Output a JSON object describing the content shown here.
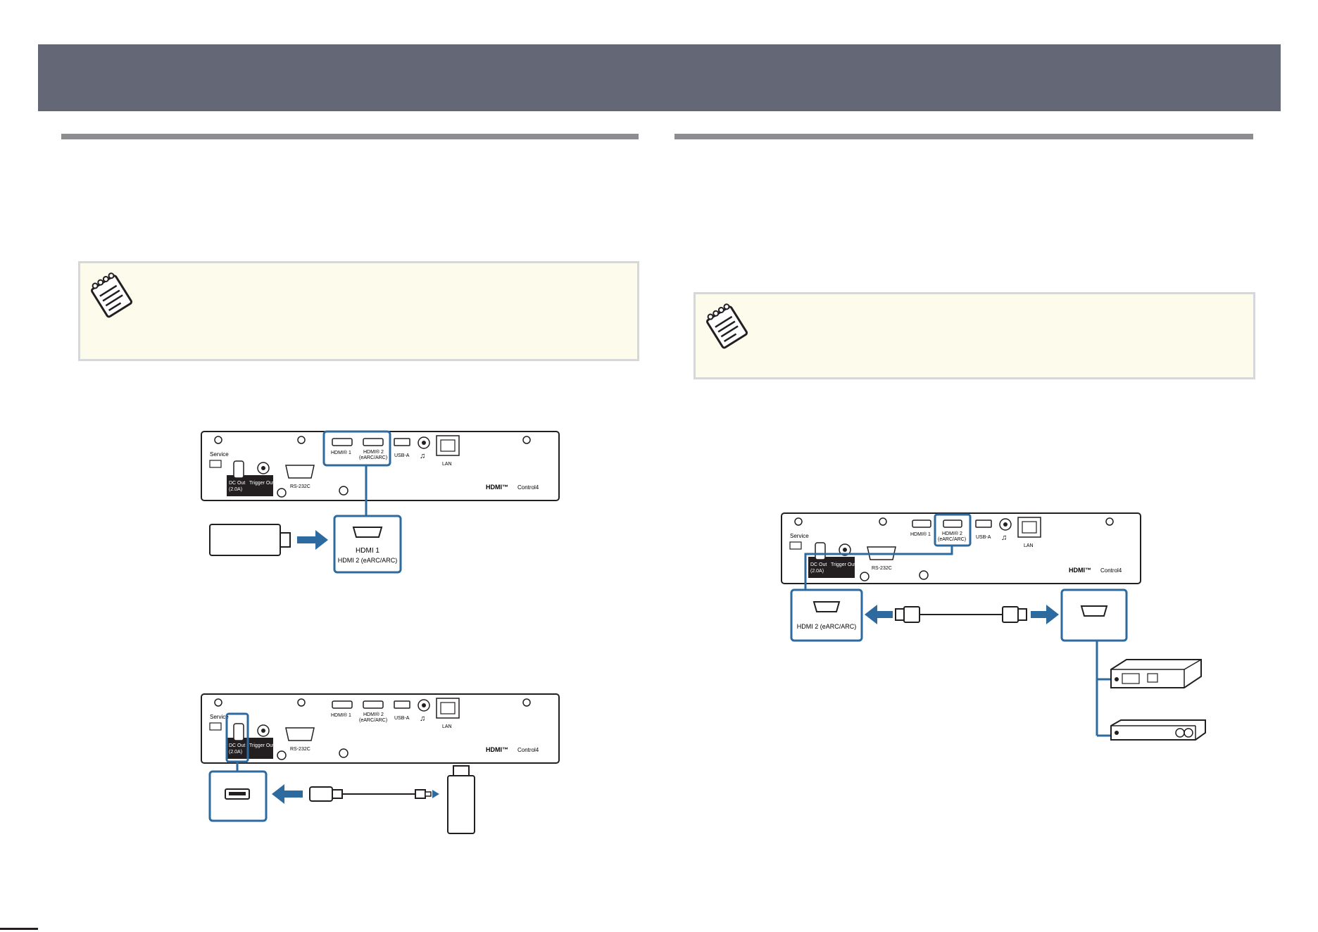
{
  "page": {
    "banner_color": "#646776",
    "rule_color": "#8c8d91",
    "note_bg_color": "#fdfbeb",
    "accent_color": "#2d6aa0"
  },
  "icons": {
    "note_left": "notepad-icon",
    "note_right": "notepad-icon"
  },
  "panel_labels": {
    "service": "Service",
    "hdmi1": "HDMI® 1",
    "hdmi2_line1": "HDMI® 2",
    "hdmi2_line2": "(eARC/ARC)",
    "usba": "USB-A",
    "lan": "LAN",
    "dcout_line1": "DC Out",
    "dcout_line2": "(2.0A)",
    "trigger_out": "Trigger Out",
    "rs232c": "RS-232C",
    "hdmi_logo": "HDMI™",
    "control4_logo": "Control4"
  },
  "figure1": {
    "callout_line1": "HDMI 1",
    "callout_line2": "HDMI 2 (eARC/ARC)"
  },
  "figure3": {
    "callout": "HDMI 2 (eARC/ARC)"
  }
}
